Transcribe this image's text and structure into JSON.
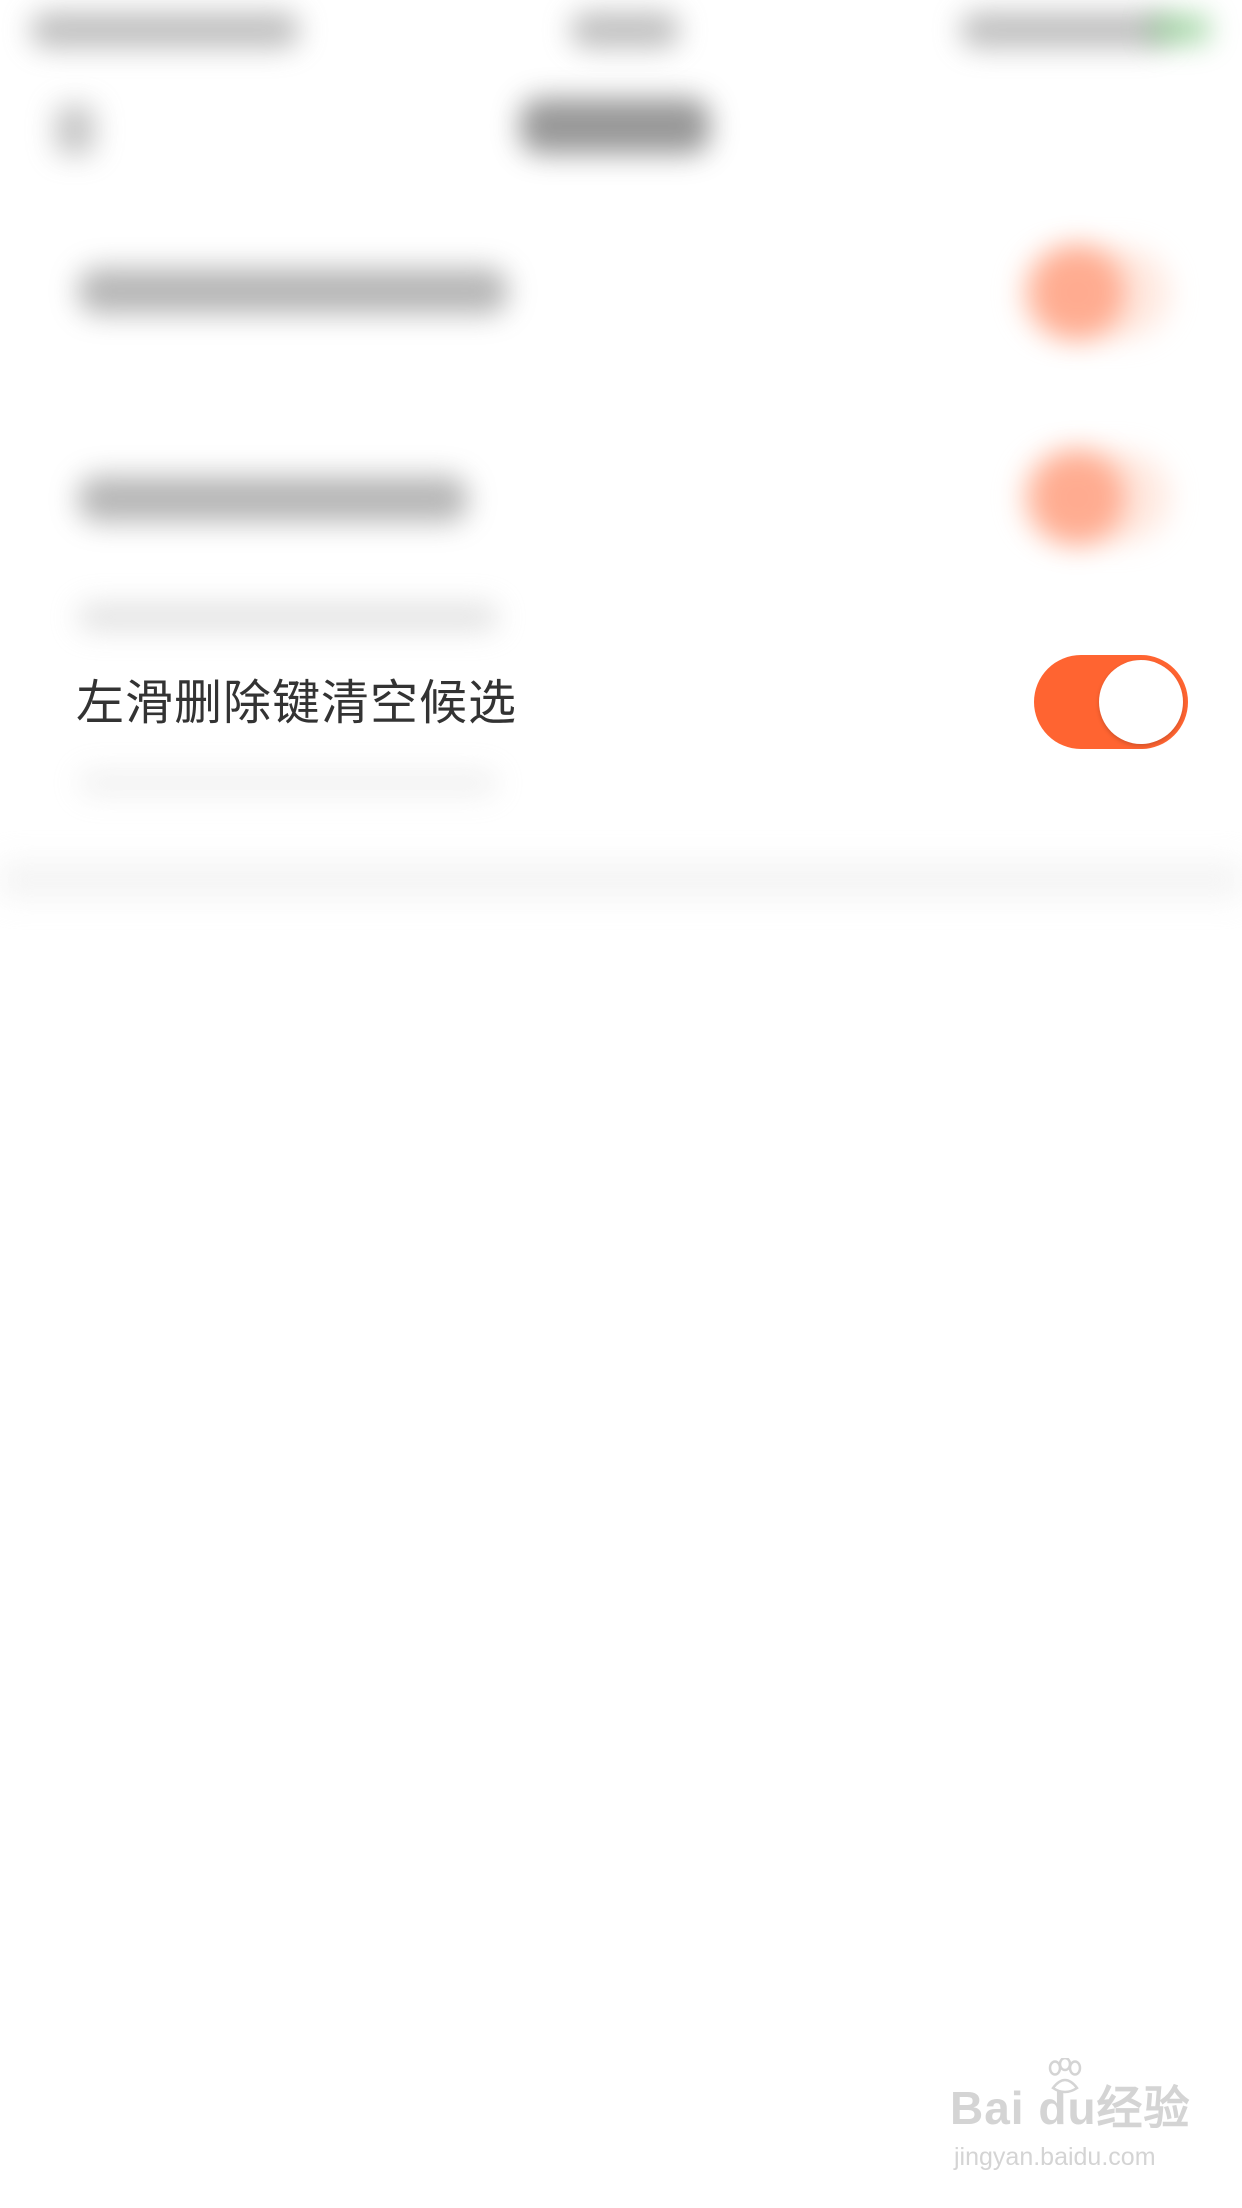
{
  "setting": {
    "label": "左滑删除键清空候选",
    "toggle_on": true
  },
  "colors": {
    "accent": "#ff6431",
    "text": "#333333",
    "background": "#ffffff",
    "watermark": "#d4d4d4"
  },
  "watermark": {
    "logo": "Bai du经验",
    "url": "jingyan.baidu.com"
  },
  "icons": {
    "watermark_paw": "baidu-paw-icon"
  }
}
